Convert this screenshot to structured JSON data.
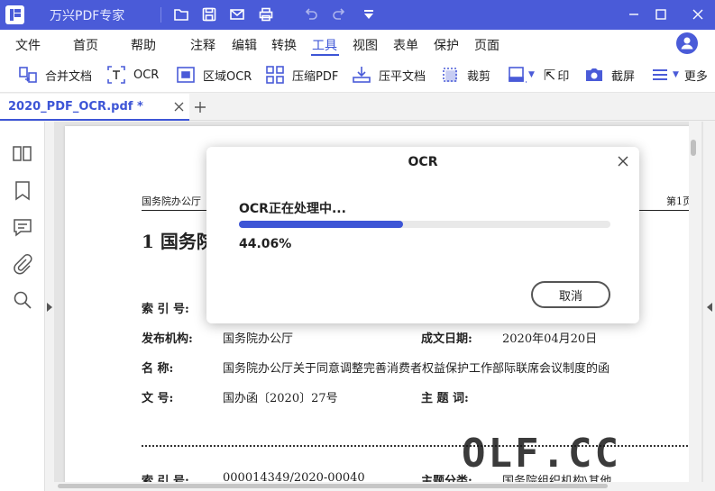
{
  "app": {
    "title": "万兴PDF专家",
    "colors": {
      "brand": "#4a5bd8",
      "accent": "#3d55d6"
    },
    "titlebar_icons": [
      "folder-icon",
      "save-icon",
      "mail-icon",
      "print-icon",
      "undo-icon",
      "redo-icon",
      "quick-access-dropdown-icon"
    ],
    "window_controls": [
      "minimize-icon",
      "maximize-icon",
      "close-icon"
    ]
  },
  "menu": {
    "items": [
      "文件",
      "首页",
      "帮助",
      "注释",
      "编辑",
      "转换",
      "工具",
      "视图",
      "表单",
      "保护",
      "页面"
    ],
    "active": "工具"
  },
  "toolbar": {
    "items": [
      {
        "label": "合并文档",
        "icon": "merge-icon"
      },
      {
        "label": "OCR",
        "icon": "ocr-icon"
      },
      {
        "label": "区域OCR",
        "icon": "area-ocr-icon"
      },
      {
        "label": "压缩PDF",
        "icon": "compress-icon"
      },
      {
        "label": "压平文档",
        "icon": "flatten-icon"
      },
      {
        "label": "裁剪",
        "icon": "crop-icon"
      },
      {
        "label": "印",
        "icon": "watermark-icon"
      },
      {
        "label": "截屏",
        "icon": "screenshot-icon"
      },
      {
        "label": "更多",
        "icon": "more-icon"
      }
    ]
  },
  "tabs": {
    "document": "2020_PDF_OCR.pdf *"
  },
  "sidebar": {
    "icons": [
      "thumbnails-icon",
      "bookmark-icon",
      "comment-icon",
      "attachment-icon",
      "search-icon"
    ]
  },
  "document": {
    "header_left": "国务院办公厅",
    "header_right": "第1页",
    "heading": "1  国务院",
    "rows": [
      {
        "label": "索 引 号:",
        "value": ""
      },
      {
        "label": "发布机构:",
        "value": "国务院办公厅",
        "label2": "成文日期:",
        "value2": "2020年04月20日"
      },
      {
        "label": "名      称:",
        "value": "国务院办公厅关于同意调整完善消费者权益保护工作部际联席会议制度的函"
      },
      {
        "label": "文      号:",
        "value": "国办函〔2020〕27号",
        "label2": "主 题 词:",
        "value2": ""
      }
    ],
    "bottom_row": {
      "label": "索 引 号:",
      "value": "000014349/2020-00040",
      "label2": "主题分类:",
      "value2": "国务院组织机构\\其他"
    }
  },
  "watermark": "OLF.CC",
  "modal": {
    "title": "OCR",
    "status": "OCR正在处理中...",
    "progress_percent": 44.06,
    "percent_label": "44.06%",
    "cancel_label": "取消"
  }
}
